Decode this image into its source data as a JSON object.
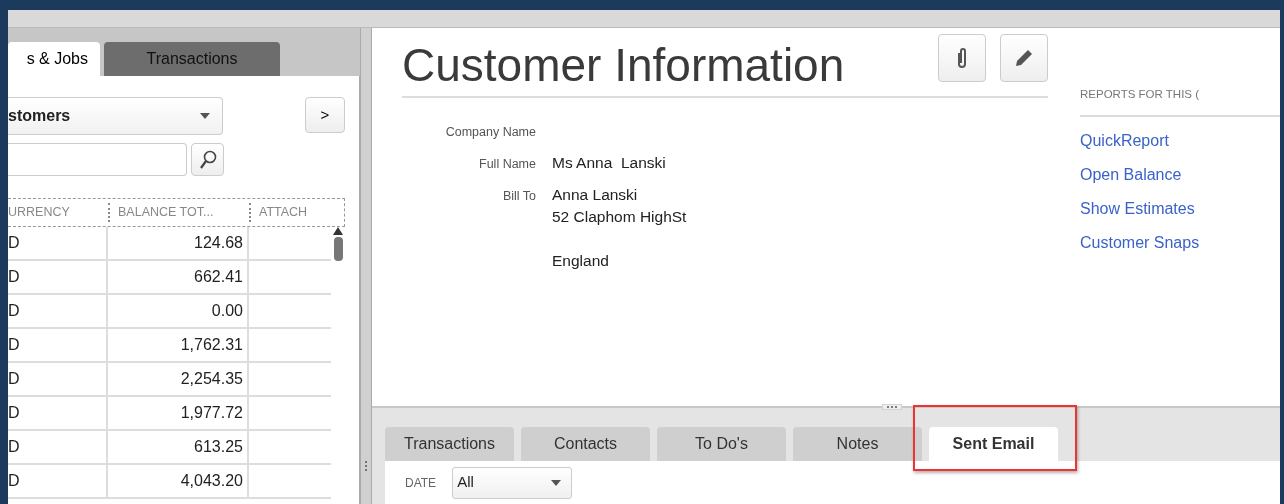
{
  "left_tabs": [
    {
      "label": "s & Jobs",
      "selected": true
    },
    {
      "label": "Transactions",
      "selected": false
    }
  ],
  "list_filter": {
    "value": "stomers"
  },
  "expand_button": {
    "label": ">"
  },
  "table": {
    "columns": [
      "URRENCY",
      "BALANCE TOT...",
      "ATTACH"
    ],
    "rows": [
      [
        "D",
        "124.68",
        ""
      ],
      [
        "D",
        "662.41",
        ""
      ],
      [
        "D",
        "0.00",
        ""
      ],
      [
        "D",
        "1,762.31",
        ""
      ],
      [
        "D",
        "2,254.35",
        ""
      ],
      [
        "D",
        "1,977.72",
        ""
      ],
      [
        "D",
        "613.25",
        ""
      ],
      [
        "D",
        "4,043.20",
        ""
      ]
    ]
  },
  "title": "Customer Information",
  "fields": [
    {
      "label": "Company Name"
    },
    {
      "label": "Full Name",
      "blocks": [
        [
          "Ms Anna  Lanski"
        ]
      ]
    },
    {
      "label": "Bill To",
      "blocks": [
        [
          "Anna Lanski",
          "52 Claphom HighSt"
        ],
        [
          "England"
        ]
      ]
    }
  ],
  "reports": {
    "heading": "REPORTS FOR THIS (",
    "links": [
      "QuickReport",
      "Open Balance",
      "Show Estimates",
      "Customer Snaps"
    ]
  },
  "bottom_tabs": [
    {
      "label": "Transactions",
      "selected": false,
      "highlighted": false
    },
    {
      "label": "Contacts",
      "selected": false,
      "highlighted": false
    },
    {
      "label": "To Do's",
      "selected": false,
      "highlighted": false
    },
    {
      "label": "Notes",
      "selected": false,
      "highlighted": false
    },
    {
      "label": "Sent Email",
      "selected": true,
      "highlighted": true
    }
  ],
  "date_filter": {
    "label": "DATE",
    "value": "All"
  }
}
